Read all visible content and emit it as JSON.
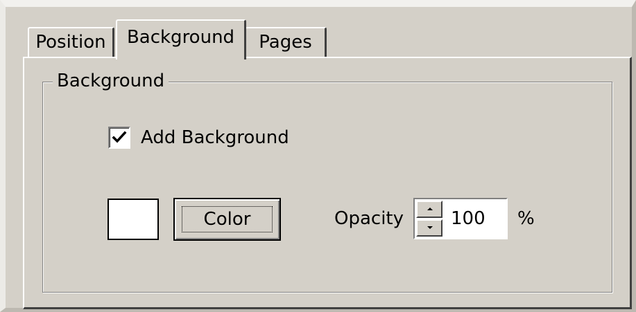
{
  "tabs": [
    {
      "label": "Position",
      "selected": false
    },
    {
      "label": "Background",
      "selected": true
    },
    {
      "label": "Pages",
      "selected": false
    }
  ],
  "group": {
    "label": "Background",
    "add_background": {
      "label": "Add Background",
      "checked": true
    },
    "swatch_color": "#ffffff",
    "color_button_label": "Color",
    "opacity": {
      "label": "Opacity",
      "value": "100",
      "unit": "%"
    }
  }
}
